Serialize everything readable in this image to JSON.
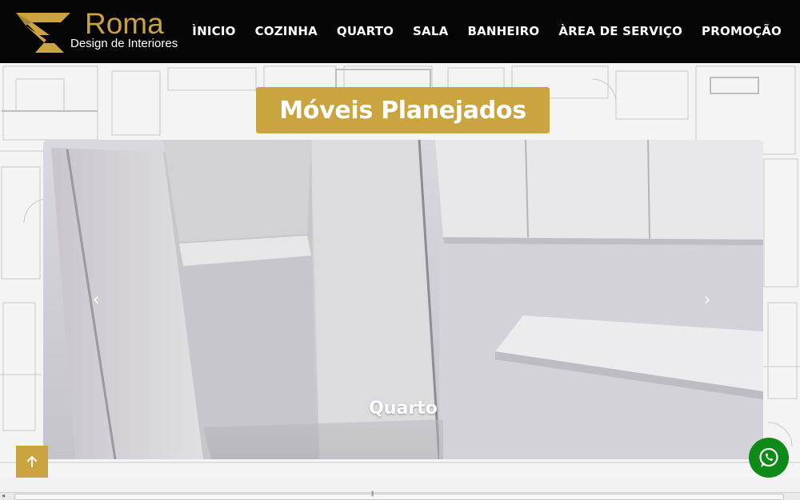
{
  "header": {
    "brand": "Roma",
    "tagline": "Design de Interiores",
    "nav": [
      "ÌNICIO",
      "COZINHA",
      "QUARTO",
      "SALA",
      "BANHEIRO",
      "ÀREA DE SERVIÇO",
      "PROMOÇÃO"
    ]
  },
  "banner": {
    "title": "Móveis Planejados"
  },
  "carousel": {
    "prev_icon": "chevron-left-icon",
    "next_icon": "chevron-right-icon",
    "caption": "Quarto",
    "prev_glyph": "‹",
    "next_glyph": "›"
  },
  "floating": {
    "to_top_icon": "arrow-up-icon",
    "whatsapp_icon": "whatsapp-icon"
  },
  "colors": {
    "header_bg": "#050505",
    "gold": "#c9a43f",
    "whatsapp_green": "#0d8a17",
    "nav_text": "#ffffff"
  }
}
